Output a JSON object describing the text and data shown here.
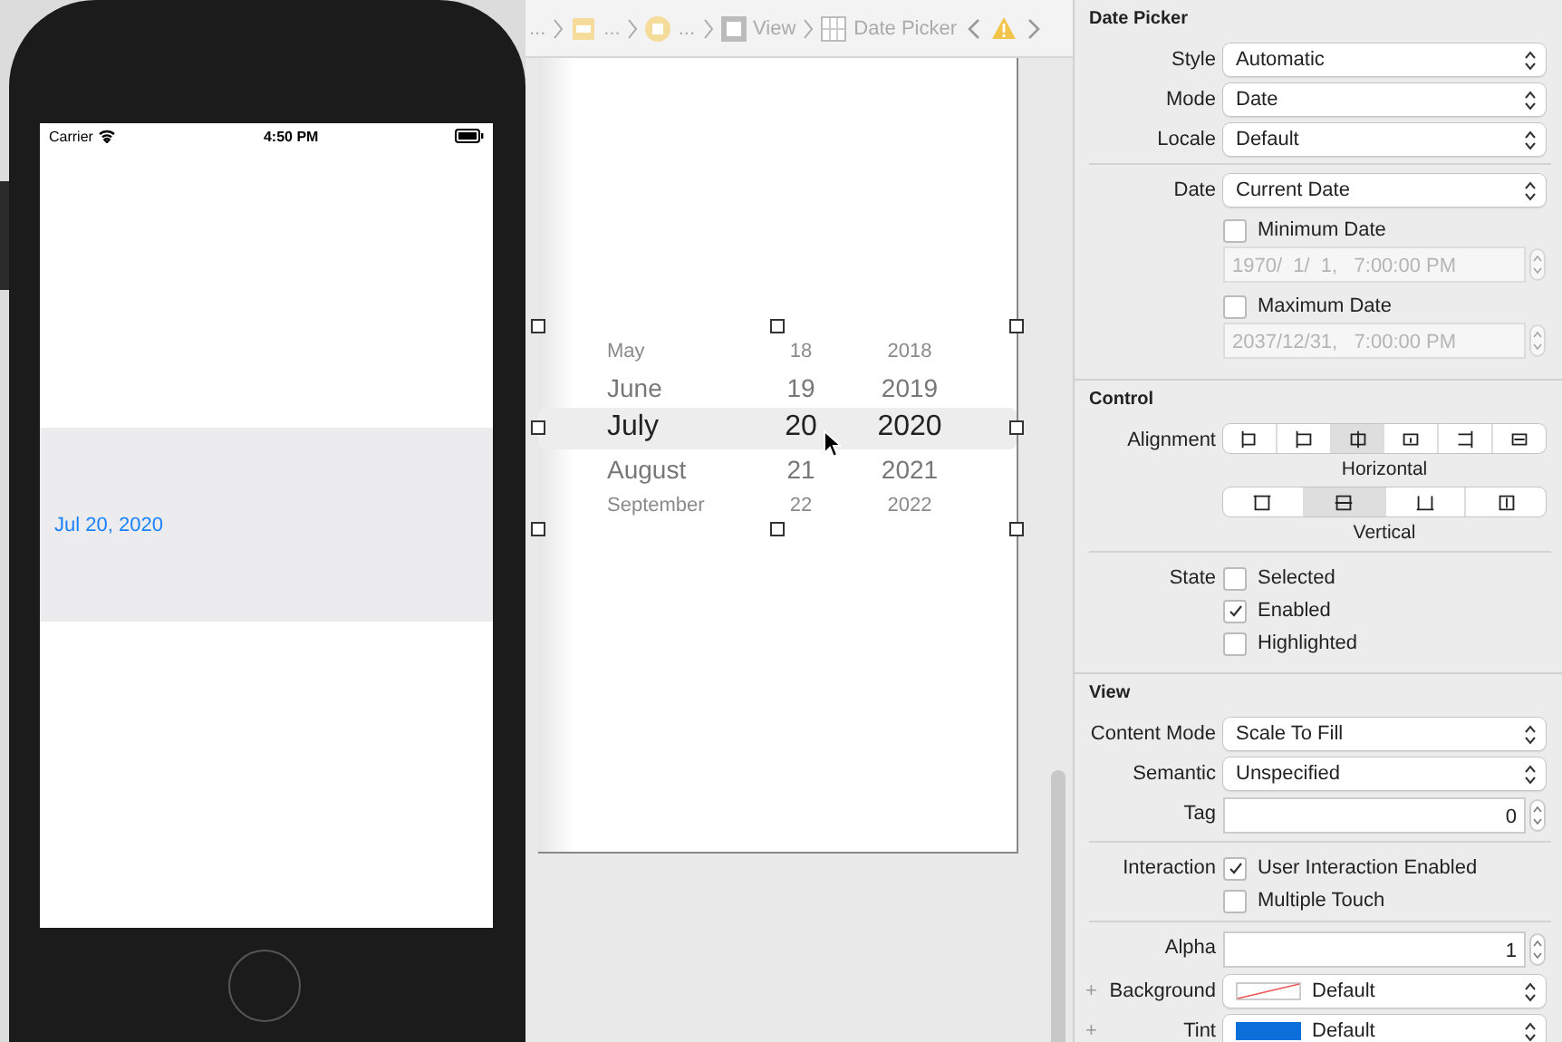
{
  "breadcrumb": {
    "items": [
      {
        "label": "...",
        "kind": "none"
      },
      {
        "label": "...",
        "kind": "scene"
      },
      {
        "label": "...",
        "kind": "controller"
      },
      {
        "label": "View",
        "kind": "view"
      },
      {
        "label": "Date Picker",
        "kind": "picker"
      }
    ],
    "warning": true
  },
  "phone": {
    "carrier": "Carrier",
    "time": "4:50 PM",
    "date_label": "Jul 20, 2020"
  },
  "picker": {
    "rows": [
      {
        "month": "May",
        "day": "18",
        "year": "2018",
        "selected": false
      },
      {
        "month": "June",
        "day": "19",
        "year": "2019",
        "selected": false
      },
      {
        "month": "July",
        "day": "20",
        "year": "2020",
        "selected": true
      },
      {
        "month": "August",
        "day": "21",
        "year": "2021",
        "selected": false
      },
      {
        "month": "September",
        "day": "22",
        "year": "2022",
        "selected": false
      }
    ]
  },
  "inspector": {
    "sections": [
      {
        "title": "Date Picker",
        "rows": [
          {
            "kind": "popup",
            "label": "Style",
            "value": "Automatic"
          },
          {
            "kind": "popup",
            "label": "Mode",
            "value": "Date"
          },
          {
            "kind": "popup",
            "label": "Locale",
            "value": "Default"
          },
          {
            "kind": "divider"
          },
          {
            "kind": "popup",
            "label": "Date",
            "value": "Current Date"
          },
          {
            "kind": "checkbox",
            "text": "Minimum Date",
            "checked": false
          },
          {
            "kind": "stepper",
            "value": "1970/  1/  1,   7:00:00 PM",
            "disabled": true
          },
          {
            "kind": "checkbox",
            "text": "Maximum Date",
            "checked": false
          },
          {
            "kind": "stepper",
            "value": "2037/12/31,   7:00:00 PM",
            "disabled": true
          }
        ]
      },
      {
        "title": "Control",
        "rows": [
          {
            "kind": "segments",
            "label": "Alignment",
            "caption": "Horizontal",
            "segments": [
              {
                "kind": "left",
                "selected": false
              },
              {
                "kind": "leading",
                "selected": false
              },
              {
                "kind": "center",
                "selected": true
              },
              {
                "kind": "top",
                "selected": false
              },
              {
                "kind": "trailing",
                "selected": false
              },
              {
                "kind": "fill",
                "selected": false
              }
            ]
          },
          {
            "kind": "segments",
            "caption": "Vertical",
            "segments": [
              {
                "kind": "vtop",
                "selected": false
              },
              {
                "kind": "vcenter",
                "selected": true
              },
              {
                "kind": "vbottom",
                "selected": false
              },
              {
                "kind": "vfill",
                "selected": false
              }
            ]
          },
          {
            "kind": "divider"
          },
          {
            "kind": "checkbox",
            "label": "State",
            "text": "Selected",
            "checked": false
          },
          {
            "kind": "checkbox",
            "text": "Enabled",
            "checked": true
          },
          {
            "kind": "checkbox",
            "text": "Highlighted",
            "checked": false
          }
        ]
      },
      {
        "title": "View",
        "rows": [
          {
            "kind": "popup",
            "label": "Content Mode",
            "value": "Scale To Fill"
          },
          {
            "kind": "popup",
            "label": "Semantic",
            "value": "Unspecified"
          },
          {
            "kind": "stepper",
            "label": "Tag",
            "value": "0",
            "disabled": false
          },
          {
            "kind": "divider"
          },
          {
            "kind": "checkbox",
            "label": "Interaction",
            "text": "User Interaction Enabled",
            "checked": true
          },
          {
            "kind": "checkbox",
            "text": "Multiple Touch",
            "checked": false
          },
          {
            "kind": "divider"
          },
          {
            "kind": "stepper",
            "label": "Alpha",
            "value": "1",
            "disabled": false
          },
          {
            "kind": "color",
            "label": "Background",
            "value": "Default",
            "plus": "+"
          },
          {
            "kind": "color",
            "label": "Tint",
            "value": "Default",
            "color": "#0a6fd8",
            "plus": "+"
          }
        ]
      }
    ]
  }
}
